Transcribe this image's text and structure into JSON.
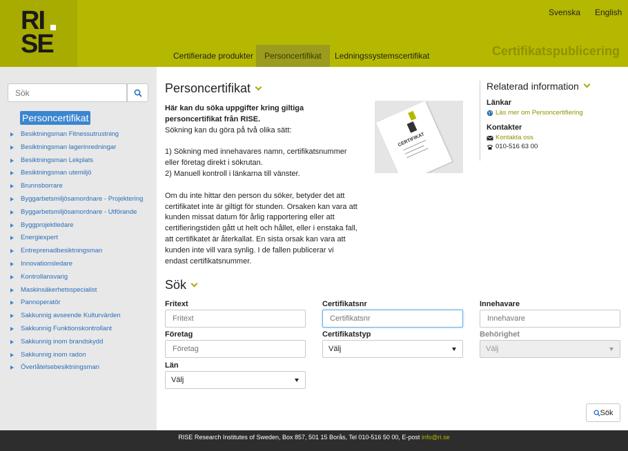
{
  "header": {
    "logo_text": "RISE",
    "lang_sv": "Svenska",
    "lang_en": "English",
    "nav": [
      "Certifierade produkter",
      "Personcertifikat",
      "Ledningssystemscertifikat"
    ],
    "site_title": "Certifikatspublicering"
  },
  "sidebar": {
    "search_placeholder": "Sök",
    "heading": "Personcertifikat",
    "items": [
      "Besiktningsman Fitnessutrustning",
      "Besiktningsman lagerinredningar",
      "Besiktningsman Lekplats",
      "Besiktningsman utemiljö",
      "Brunnsborrare",
      "Byggarbetsmiljösamordnare - Projektering",
      "Byggarbetsmiljösamordnare - Utförande",
      "Byggprojektledare",
      "Energiexpert",
      "Entreprenadbesiktningsman",
      "Innovationsledare",
      "Kontrollansvarig",
      "Maskinsäkerhetsspecialist",
      "Pannoperatör",
      "Sakkunnig avseende Kulturvärden",
      "Sakkunnig Funktionskontrollant",
      "Sakkunnig inom brandskydd",
      "Sakkunnig inom radon",
      "Överlåtelsebesiktningsman"
    ]
  },
  "main": {
    "title": "Personcertifikat",
    "intro_bold": "Här kan du söka uppgifter kring giltiga personcertifikat från RISE.",
    "intro_p1": "Sökning kan du göra på två olika sätt:",
    "intro_p2": "1) Sökning med innehavares namn, certifikatsnummer eller företag direkt i sökrutan.",
    "intro_p3": "2) Manuell kontroll i länkarna till vänster.",
    "intro_p4": "Om du inte hittar den person du söker, betyder det att certifikatet inte är giltigt för stunden. Orsaken kan vara att kunden missat datum för årlig rapportering eller att certifieringstiden gått ut helt och hållet, eller i enstaka fall, att certifikatet är återkallat. En sista orsak kan vara att kunden inte vill vara synlig. I de fallen publicerar vi endast certifikatsnummer.",
    "cert_image_text": "CERTIFIKAT"
  },
  "related": {
    "title": "Relaterad information",
    "links_heading": "Länkar",
    "link_text": "Läs mer om Personcertifiering",
    "contacts_heading": "Kontakter",
    "contact_link": "Kontakta oss",
    "phone": "010-516 63 00"
  },
  "search": {
    "title": "Sök",
    "fritext_label": "Fritext",
    "fritext_placeholder": "Fritext",
    "certnr_label": "Certifikatsnr",
    "certnr_placeholder": "Certifikatsnr",
    "innehavare_label": "Innehavare",
    "innehavare_placeholder": "Innehavare",
    "foretag_label": "Företag",
    "foretag_placeholder": "Företag",
    "certtyp_label": "Certifikatstyp",
    "certtyp_value": "Välj",
    "behorighet_label": "Behörighet",
    "behorighet_value": "Välj",
    "lan_label": "Län",
    "lan_value": "Välj",
    "submit_label": "Sök"
  },
  "footer": {
    "text": "RISE Research Institutes of Sweden, Box 857, 501 15 Borås, Tel 010-516 50 00, E-post ",
    "email": "info@ri.se"
  },
  "colors": {
    "brand": "#b5b800",
    "link": "#2a6fb8",
    "footer_bg": "#2d2d2d"
  }
}
